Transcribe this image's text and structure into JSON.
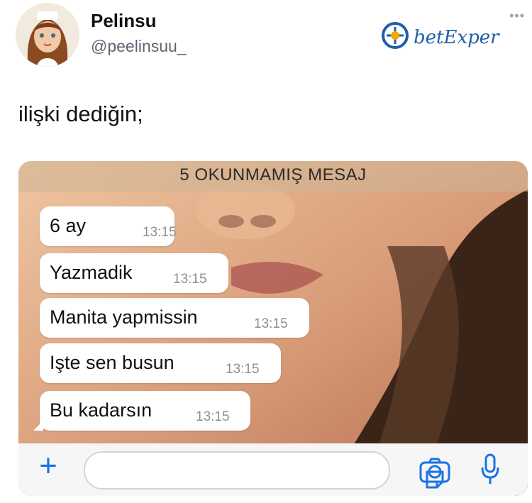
{
  "tweet": {
    "author_name": "Pelinsu",
    "author_handle": "@peelinsuu_",
    "more_menu": "•••",
    "text": "ilişki dediğin;"
  },
  "watermark": {
    "brand_text": "betExper"
  },
  "chat": {
    "unread_banner": "5 OKUNMAMIŞ MESAJ",
    "messages": [
      {
        "text": "6 ay",
        "time": "13:15"
      },
      {
        "text": "Yazmadik",
        "time": "13:15"
      },
      {
        "text": "Manita yapmissin",
        "time": "13:15"
      },
      {
        "text": "Işte sen busun",
        "time": "13:15"
      },
      {
        "text": "Bu kadarsın",
        "time": "13:15"
      }
    ],
    "input": {
      "plus": "+"
    }
  },
  "colors": {
    "accent": "#1b74e4",
    "bubble": "#ffffff",
    "timestamp": "#8a9096"
  },
  "icons": [
    "avatar",
    "more-icon",
    "plus-icon",
    "sticker-icon",
    "camera-icon",
    "microphone-icon"
  ]
}
